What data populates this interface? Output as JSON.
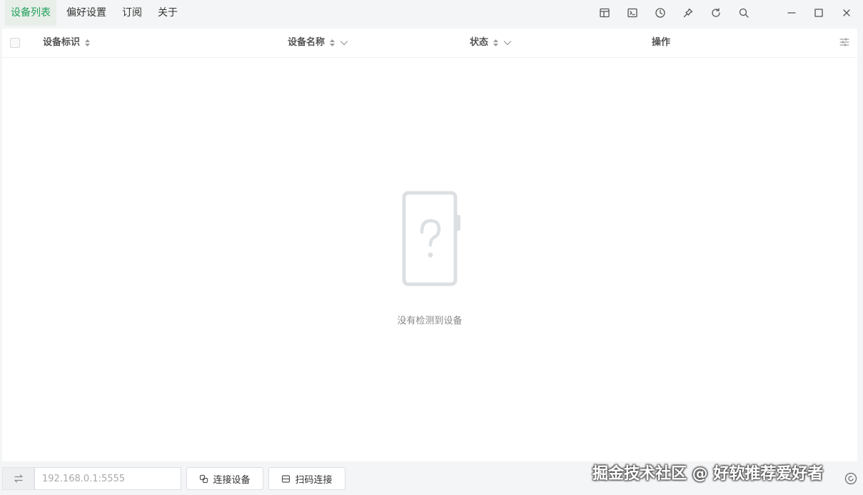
{
  "nav": {
    "tabs": [
      {
        "label": "设备列表",
        "active": true
      },
      {
        "label": "偏好设置",
        "active": false
      },
      {
        "label": "订阅",
        "active": false
      },
      {
        "label": "关于",
        "active": false
      }
    ]
  },
  "toolbar": {
    "icons": [
      "layout-icon",
      "terminal-icon",
      "history-icon",
      "pin-icon",
      "refresh-icon",
      "search-icon"
    ],
    "window_controls": [
      "minimize-icon",
      "maximize-icon",
      "close-icon"
    ]
  },
  "table": {
    "columns": {
      "id": "设备标识",
      "name": "设备名称",
      "status": "状态",
      "actions": "操作"
    },
    "empty_text": "没有检测到设备"
  },
  "bottom": {
    "address_placeholder": "192.168.0.1:5555",
    "connect_label": "连接设备",
    "qr_label": "扫码连接"
  },
  "watermark": "掘金技术社区 @ 好软推荐爱好者",
  "colors": {
    "accent": "#22a05a",
    "background": "#f4f5f6"
  }
}
